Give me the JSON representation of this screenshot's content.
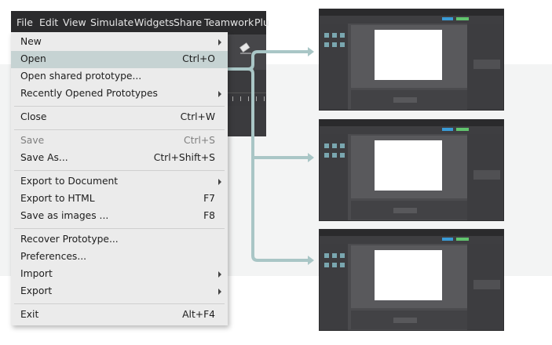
{
  "menubar": {
    "items": [
      "File",
      "Edit",
      "View",
      "Simulate",
      "Widgets",
      "Share",
      "Teamwork",
      "Plu"
    ]
  },
  "file_menu": {
    "items": [
      {
        "label": "New",
        "shortcut": "",
        "submenu": true,
        "disabled": false,
        "highlighted": false
      },
      {
        "label": "Open",
        "shortcut": "Ctrl+O",
        "submenu": false,
        "disabled": false,
        "highlighted": true
      },
      {
        "label": "Open shared prototype...",
        "shortcut": "",
        "submenu": false,
        "disabled": false,
        "highlighted": false
      },
      {
        "label": "Recently Opened Prototypes",
        "shortcut": "",
        "submenu": true,
        "disabled": false,
        "highlighted": false
      },
      {
        "label": "Close",
        "shortcut": "Ctrl+W",
        "submenu": false,
        "disabled": false,
        "highlighted": false
      },
      {
        "label": "Save",
        "shortcut": "Ctrl+S",
        "submenu": false,
        "disabled": true,
        "highlighted": false
      },
      {
        "label": "Save As...",
        "shortcut": "Ctrl+Shift+S",
        "submenu": false,
        "disabled": false,
        "highlighted": false
      },
      {
        "label": "Export to Document",
        "shortcut": "",
        "submenu": true,
        "disabled": false,
        "highlighted": false
      },
      {
        "label": "Export to HTML",
        "shortcut": "F7",
        "submenu": false,
        "disabled": false,
        "highlighted": false
      },
      {
        "label": "Save as images ...",
        "shortcut": "F8",
        "submenu": false,
        "disabled": false,
        "highlighted": false
      },
      {
        "label": "Recover Prototype...",
        "shortcut": "",
        "submenu": false,
        "disabled": false,
        "highlighted": false
      },
      {
        "label": "Preferences...",
        "shortcut": "",
        "submenu": false,
        "disabled": false,
        "highlighted": false
      },
      {
        "label": "Import",
        "shortcut": "",
        "submenu": true,
        "disabled": false,
        "highlighted": false
      },
      {
        "label": "Export",
        "shortcut": "",
        "submenu": true,
        "disabled": false,
        "highlighted": false
      },
      {
        "label": "Exit",
        "shortcut": "Alt+F4",
        "submenu": false,
        "disabled": false,
        "highlighted": false
      }
    ]
  },
  "colors": {
    "highlight": "#c6d3d3",
    "connector": "#a9c6c6",
    "menu_bg": "#ebebeb",
    "app_dark": "#2b2b2d"
  },
  "icons": {
    "submenu": "submenu-arrow-icon",
    "eraser": "eraser-icon",
    "connector_arrow": "arrow-right-icon"
  },
  "thumbnails": [
    {
      "name": "prototype-window-1"
    },
    {
      "name": "prototype-window-2"
    },
    {
      "name": "prototype-window-3"
    }
  ]
}
